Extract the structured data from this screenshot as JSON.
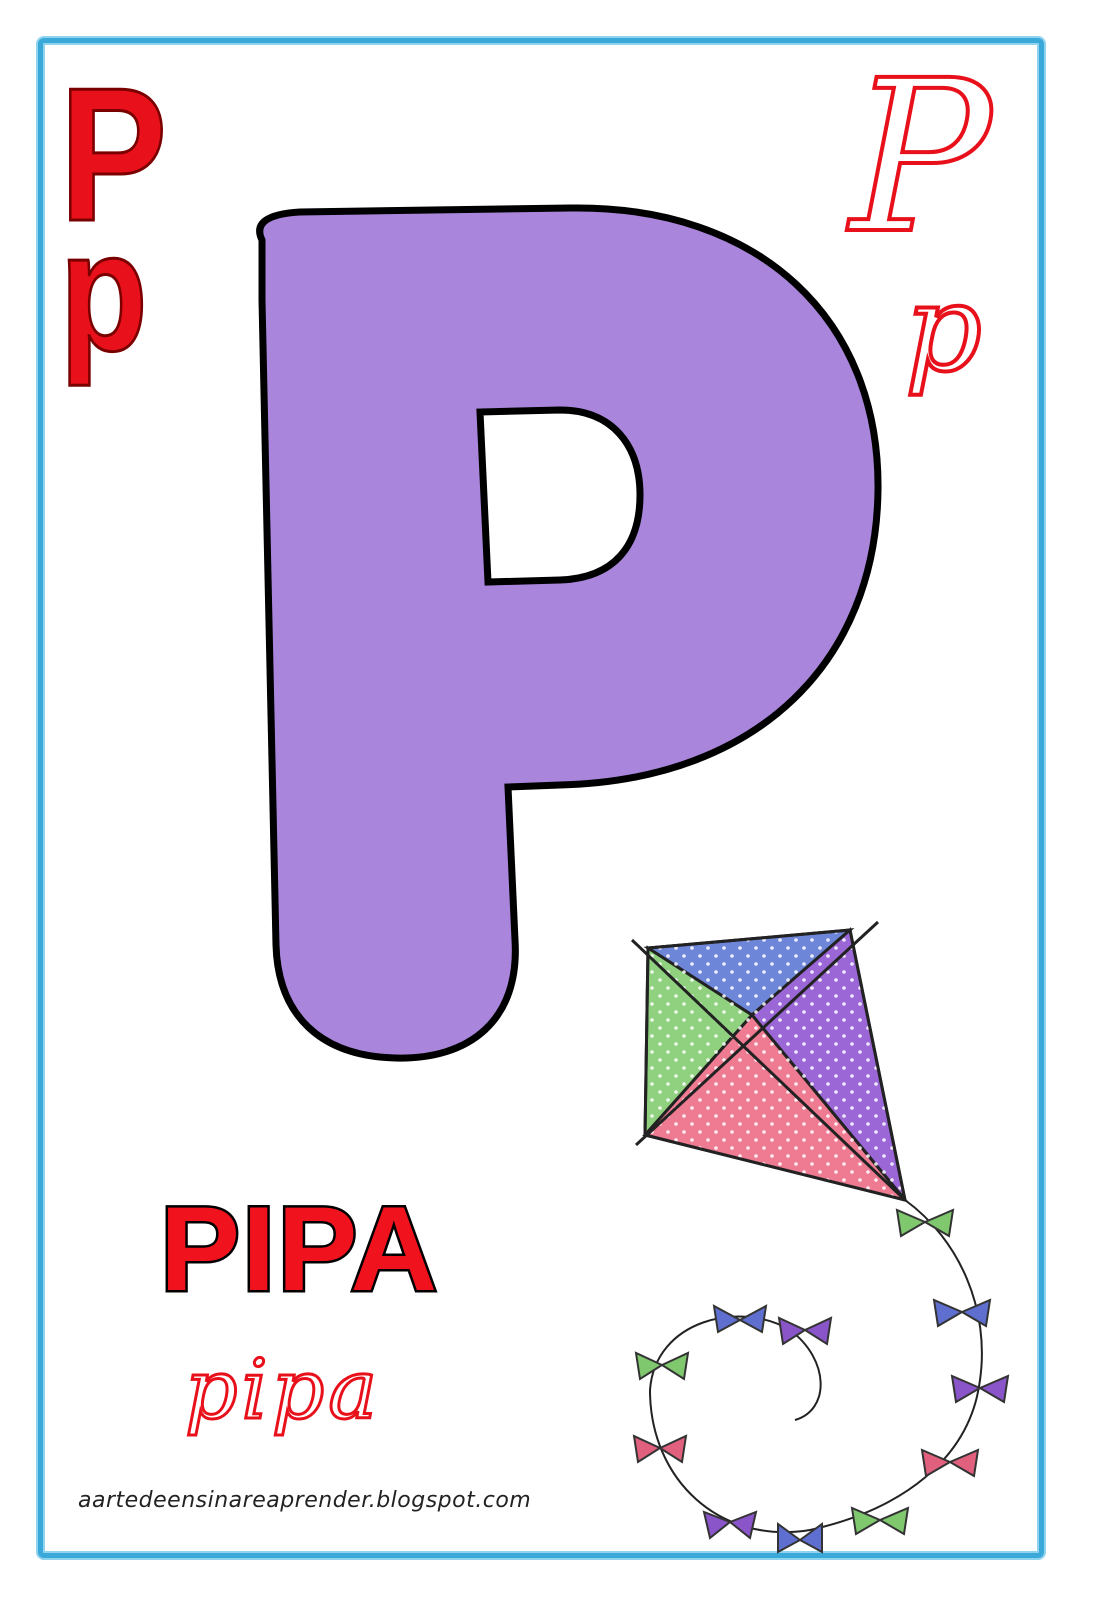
{
  "card": {
    "border_color": "#3aa9d9",
    "letter_fill": "#a986dc",
    "accent_red": "#e8101a"
  },
  "print_letters": {
    "upper": "P",
    "lower": "p"
  },
  "cursive_letters": {
    "upper": "P",
    "lower": "p"
  },
  "big_letter": "P",
  "word": {
    "print": "PIPA",
    "cursive": "pipa"
  },
  "illustration": {
    "icon": "kite-icon"
  },
  "footer": {
    "credit": "aartedeensinareaprender.blogspot.com"
  }
}
